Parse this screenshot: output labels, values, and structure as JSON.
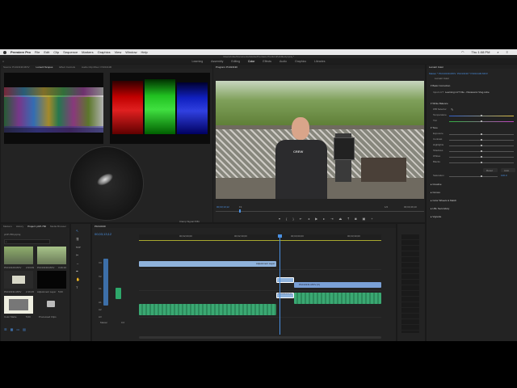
{
  "menubar": {
    "apple": "",
    "app_name": "Premiere Pro",
    "items": [
      "File",
      "Edit",
      "Clip",
      "Sequence",
      "Markers",
      "Graphics",
      "View",
      "Window",
      "Help"
    ],
    "clock": "Thu 1:08 PM"
  },
  "window_title": "/Users/mike/Documents/Adobe/Premiere Pro/12.0/Untitled.prproj *",
  "workspace": {
    "tabs": [
      "Learning",
      "Assembly",
      "Editing",
      "Color",
      "Effects",
      "Audio",
      "Graphics",
      "Libraries"
    ],
    "active": "Color"
  },
  "source_panel": {
    "tabs": [
      "Source: P1013130.MOV",
      "Lumetri Scopes",
      "Effect Controls",
      "Audio Clip Mixer: P1013130"
    ],
    "active_tab": "Lumetri Scopes",
    "clamp_label": "Clamp Signal",
    "clamp_value": "8 Bit"
  },
  "program": {
    "title": "Program: P1013130",
    "timecode_in": "00;03;13;12",
    "fit": "Fit",
    "resolution": "1/2",
    "timecode_total": "00;03;49;10"
  },
  "project": {
    "tabs": [
      "Markers",
      "History",
      "Project: pCP-760",
      "Media Browser"
    ],
    "active_tab": "Project: pCP-760",
    "search_placeholder": "pCP-760.prproj",
    "items": [
      {
        "name": "P1013129.MOV",
        "dur": "2:03:09"
      },
      {
        "name": "P1013130.MOV",
        "dur": "3:49:10"
      },
      {
        "name": "P1013131.MOV",
        "dur": "2:19:15"
      },
      {
        "name": "Adjustment Layer",
        "dur": "5;00"
      },
      {
        "name": "Color Matte",
        "dur": "5;00"
      },
      {
        "name": "Processed Clips",
        "dur": ""
      }
    ]
  },
  "timeline": {
    "sequence": "P1013130",
    "timecode": "00;03;13;12",
    "ruler": [
      "00;02;00;00",
      "00;02;30;00",
      "00;03;00;00",
      "00;03;30;00"
    ],
    "video_tracks": [
      "V3",
      "V2",
      "V1"
    ],
    "audio_tracks": [
      "A1",
      "A2",
      "A3"
    ],
    "master_label": "Master",
    "master_value": "0.0",
    "clips": {
      "v2": "Adjustment Layer",
      "v1a": "P1013130.MOV [V]",
      "v1b": "P1013131.MOV [V]"
    }
  },
  "lumetri": {
    "title": "Lumetri Color",
    "clip": "Master * P1013130.MOV",
    "clip2": "P1013130 * P1013130.MOV",
    "fx": "Lumetri Color",
    "basic": "Basic Correction",
    "input_lut": "Input LUT",
    "input_lut_value": "Learning LUT File - Panasonic Vlog.cube",
    "white_balance": "White Balance",
    "wb_selector": "WB Selector",
    "temperature": "Temperature",
    "tint": "Tint",
    "tone": "Tone",
    "tone_rows": [
      "Exposure",
      "Contrast",
      "Highlights",
      "Shadows",
      "Whites",
      "Blacks"
    ],
    "reset": "Reset",
    "auto": "Auto",
    "saturation": "Saturation",
    "saturation_value": "100.0",
    "sections": [
      "Creative",
      "Curves",
      "Color Wheels & Match",
      "HSL Secondary",
      "Vignette"
    ]
  },
  "colors": {
    "accent_blue": "#4a90e2",
    "clip_blue": "#8fb3dc",
    "audio_green": "#3aa872",
    "playhead": "#4a90e2"
  }
}
